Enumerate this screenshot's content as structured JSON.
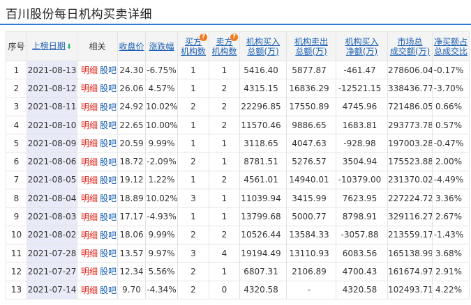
{
  "page": {
    "title": "百川股份每日机构买卖详细"
  },
  "table": {
    "headers": {
      "seq": "序号",
      "date": "上榜日期",
      "related": "相关",
      "close": "收盘价",
      "change": "涨跌幅",
      "buy_inst_1": "买方",
      "buy_inst_2": "机构数",
      "sell_inst_1": "卖方",
      "sell_inst_2": "机构数",
      "inst_buy_1": "机构买入",
      "inst_buy_2": "总额(万)",
      "inst_sell_1": "机构卖出",
      "inst_sell_2": "总额(万)",
      "inst_net_1": "机构买入",
      "inst_net_2": "净额(万)",
      "market_1": "市场总",
      "market_2": "成交额(万)",
      "ratio_1": "净买额占",
      "ratio_2": "总成交比"
    },
    "sort_arrow": "⬇",
    "help_icon": "?",
    "link_detail": "明细",
    "link_bar": "股吧",
    "rows": [
      {
        "seq": "1",
        "date": "2021-08-13",
        "close": "24.30",
        "change": "-6.75%",
        "buy_n": "1",
        "sell_n": "1",
        "buy": "5416.40",
        "sell": "5877.87",
        "net": "-461.47",
        "market": "278606.04",
        "ratio": "-0.17%"
      },
      {
        "seq": "2",
        "date": "2021-08-12",
        "close": "26.06",
        "change": "4.57%",
        "buy_n": "1",
        "sell_n": "2",
        "buy": "4315.15",
        "sell": "16836.29",
        "net": "-12521.15",
        "market": "338436.77",
        "ratio": "-3.70%"
      },
      {
        "seq": "3",
        "date": "2021-08-11",
        "close": "24.92",
        "change": "10.02%",
        "buy_n": "2",
        "sell_n": "2",
        "buy": "22296.85",
        "sell": "17550.89",
        "net": "4745.96",
        "market": "721486.05",
        "ratio": "0.66%"
      },
      {
        "seq": "4",
        "date": "2021-08-10",
        "close": "22.65",
        "change": "10.00%",
        "buy_n": "1",
        "sell_n": "2",
        "buy": "11570.46",
        "sell": "9886.65",
        "net": "1683.81",
        "market": "293773.78",
        "ratio": "0.57%"
      },
      {
        "seq": "5",
        "date": "2021-08-09",
        "close": "20.59",
        "change": "9.99%",
        "buy_n": "1",
        "sell_n": "1",
        "buy": "3118.65",
        "sell": "4047.63",
        "net": "-928.98",
        "market": "197003.28",
        "ratio": "-0.47%"
      },
      {
        "seq": "6",
        "date": "2021-08-06",
        "close": "18.72",
        "change": "-2.09%",
        "buy_n": "2",
        "sell_n": "1",
        "buy": "8781.51",
        "sell": "5276.57",
        "net": "3504.94",
        "market": "175523.88",
        "ratio": "2.00%"
      },
      {
        "seq": "7",
        "date": "2021-08-05",
        "close": "19.12",
        "change": "1.22%",
        "buy_n": "1",
        "sell_n": "2",
        "buy": "4561.01",
        "sell": "14940.01",
        "net": "-10379.00",
        "market": "231370.02",
        "ratio": "-4.49%"
      },
      {
        "seq": "8",
        "date": "2021-08-04",
        "close": "18.89",
        "change": "10.02%",
        "buy_n": "3",
        "sell_n": "1",
        "buy": "11039.94",
        "sell": "3415.99",
        "net": "7623.95",
        "market": "227224.72",
        "ratio": "3.36%"
      },
      {
        "seq": "9",
        "date": "2021-08-03",
        "close": "17.17",
        "change": "-4.93%",
        "buy_n": "1",
        "sell_n": "1",
        "buy": "13799.68",
        "sell": "5000.77",
        "net": "8798.91",
        "market": "329116.27",
        "ratio": "2.67%"
      },
      {
        "seq": "10",
        "date": "2021-08-02",
        "close": "18.06",
        "change": "9.99%",
        "buy_n": "2",
        "sell_n": "2",
        "buy": "10526.44",
        "sell": "13584.33",
        "net": "-3057.88",
        "market": "213559.17",
        "ratio": "-1.43%"
      },
      {
        "seq": "11",
        "date": "2021-07-28",
        "close": "13.57",
        "change": "9.97%",
        "buy_n": "3",
        "sell_n": "4",
        "buy": "19194.49",
        "sell": "13110.93",
        "net": "6083.56",
        "market": "165138.99",
        "ratio": "3.68%"
      },
      {
        "seq": "12",
        "date": "2021-07-27",
        "close": "12.34",
        "change": "5.56%",
        "buy_n": "2",
        "sell_n": "1",
        "buy": "6807.31",
        "sell": "2106.89",
        "net": "4700.43",
        "market": "161674.97",
        "ratio": "2.91%"
      },
      {
        "seq": "13",
        "date": "2021-07-14",
        "close": "9.70",
        "change": "-4.34%",
        "buy_n": "2",
        "sell_n": "0",
        "buy": "4320.58",
        "sell": "-",
        "net": "4320.58",
        "market": "102493.71",
        "ratio": "4.22%"
      }
    ]
  },
  "colors": {
    "up": "#e4251b",
    "down": "#12a43d",
    "accent": "#2e7bd6",
    "help": "#f27a1f"
  }
}
